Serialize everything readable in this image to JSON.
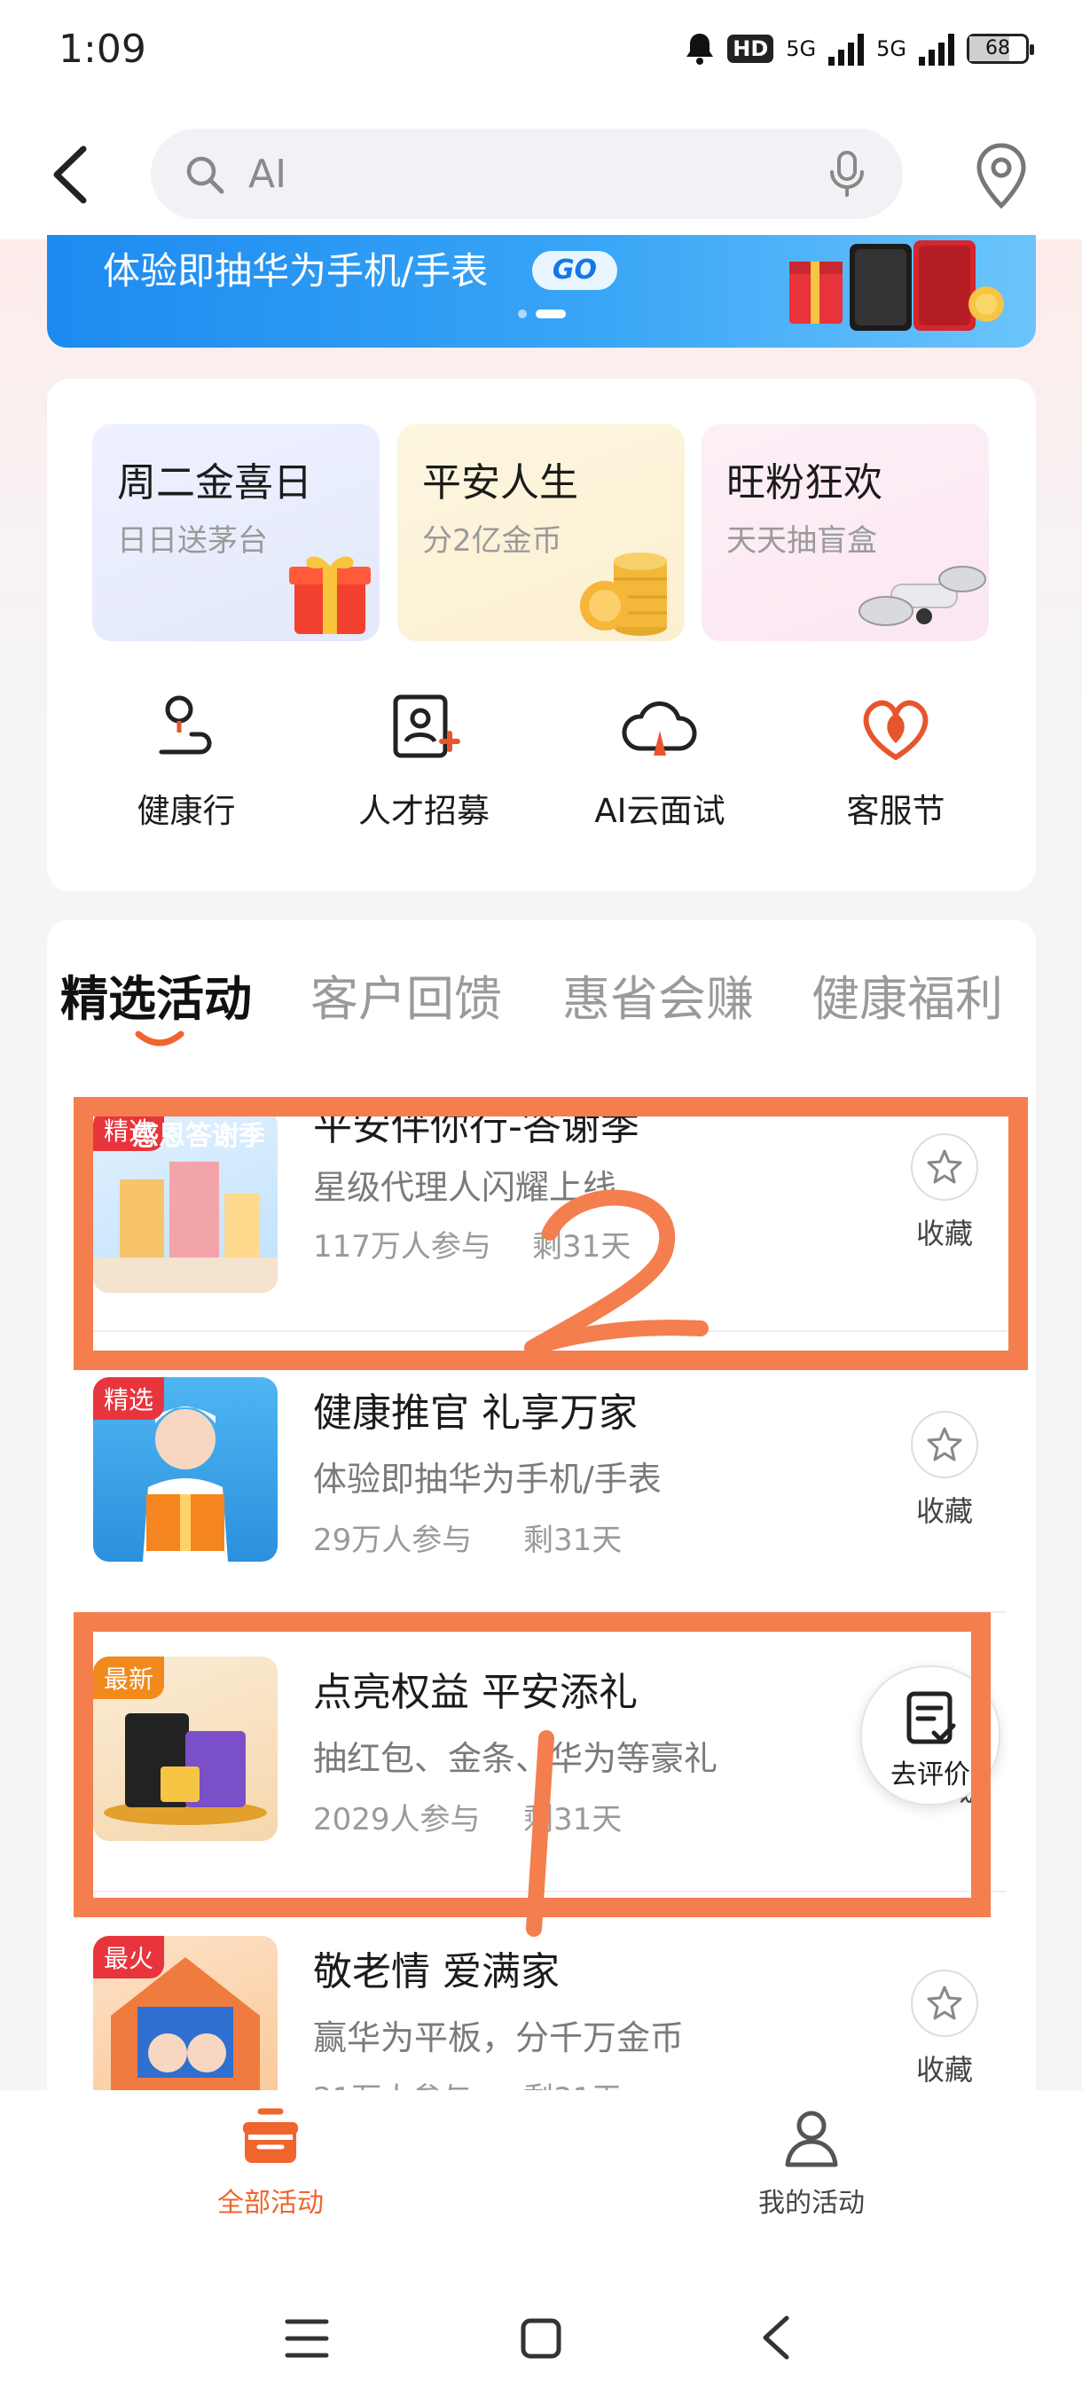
{
  "status_bar": {
    "time": "1:09",
    "hd": "HD",
    "hd_sub": "1/2",
    "net1": "5G",
    "net2": "5G",
    "battery": "68"
  },
  "search": {
    "placeholder": "AI"
  },
  "banner": {
    "text": "体验即抽华为手机/手表",
    "go": "GO"
  },
  "promos": [
    {
      "title": "周二金喜日",
      "subtitle": "日日送茅台"
    },
    {
      "title": "平安人生",
      "subtitle": "分2亿金币"
    },
    {
      "title": "旺粉狂欢",
      "subtitle": "天天抽盲盒"
    }
  ],
  "quick_links": [
    {
      "label": "健康行",
      "icon": "person-route-icon"
    },
    {
      "label": "人才招募",
      "icon": "id-card-plus-icon"
    },
    {
      "label": "AI云面试",
      "icon": "cloud-icon"
    },
    {
      "label": "客服节",
      "icon": "heart-flame-icon"
    }
  ],
  "tabs": [
    {
      "label": "精选活动",
      "active": true
    },
    {
      "label": "客户回馈",
      "active": false
    },
    {
      "label": "惠省会赚",
      "active": false
    },
    {
      "label": "健康福利",
      "active": false
    }
  ],
  "activities": [
    {
      "badge": "精选",
      "thumb_text": "感恩答谢季",
      "title": "平安伴你行-答谢季",
      "subtitle": "星级代理人闪耀上线",
      "participants": "117万人参与",
      "remaining": "剩31天",
      "action": "收藏"
    },
    {
      "badge": "精选",
      "title": "健康推官 礼享万家",
      "subtitle": "体验即抽华为手机/手表",
      "participants": "29万人参与",
      "remaining": "剩31天",
      "action": "收藏"
    },
    {
      "badge": "最新",
      "title": "点亮权益 平安添礼",
      "subtitle": "抽红包、金条、华为等豪礼",
      "participants": "2029人参与",
      "remaining": "剩31天",
      "action": "收藏"
    },
    {
      "badge": "最火",
      "title": "敬老情 爱满家",
      "subtitle": "赢华为平板，分千万金币",
      "participants": "21万人参与",
      "remaining": "剩31天",
      "action": "收藏"
    }
  ],
  "review_button": {
    "label": "去评价"
  },
  "annotations": [
    "2",
    "1"
  ],
  "bottom_nav": [
    {
      "label": "全部活动",
      "active": true
    },
    {
      "label": "我的活动",
      "active": false
    }
  ],
  "colors": {
    "accent": "#f0652e",
    "annotation": "#f47e4e",
    "badge_red": "#e8343c",
    "badge_orange": "#f08a1c",
    "banner_blue": "#2a95f3"
  }
}
